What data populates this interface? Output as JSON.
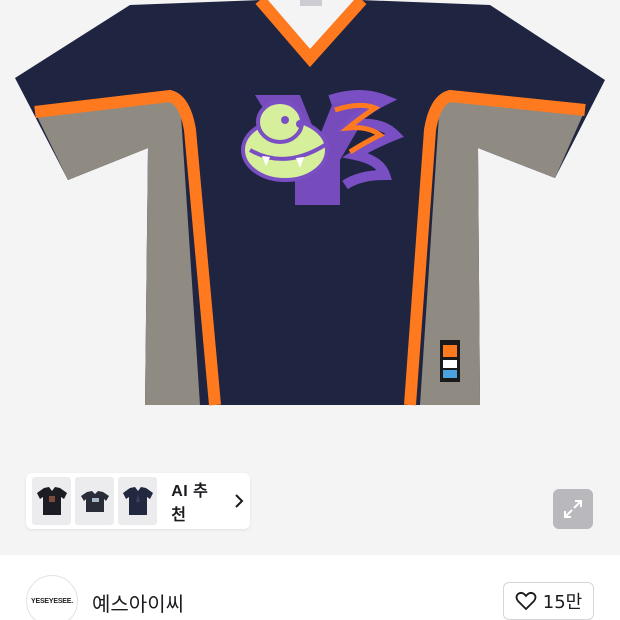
{
  "product": {
    "image_alt": "Navy V-neck jersey tee with orange piping, grey side panels and purple dinosaur Y graphic",
    "colors": {
      "navy": "#1f2440",
      "orange": "#ff7a1e",
      "grey": "#8f8a82",
      "purple": "#7b4fc4",
      "lime": "#d6ef9a"
    }
  },
  "recommend": {
    "label": "AI 추천",
    "thumb_icons": [
      "tshirt-black-icon",
      "tshirt-flat-icon",
      "tshirt-navy-icon"
    ]
  },
  "brand": {
    "name": "예스아이씨",
    "logo_text": "YESEYESEE."
  },
  "like": {
    "count": "15만"
  }
}
